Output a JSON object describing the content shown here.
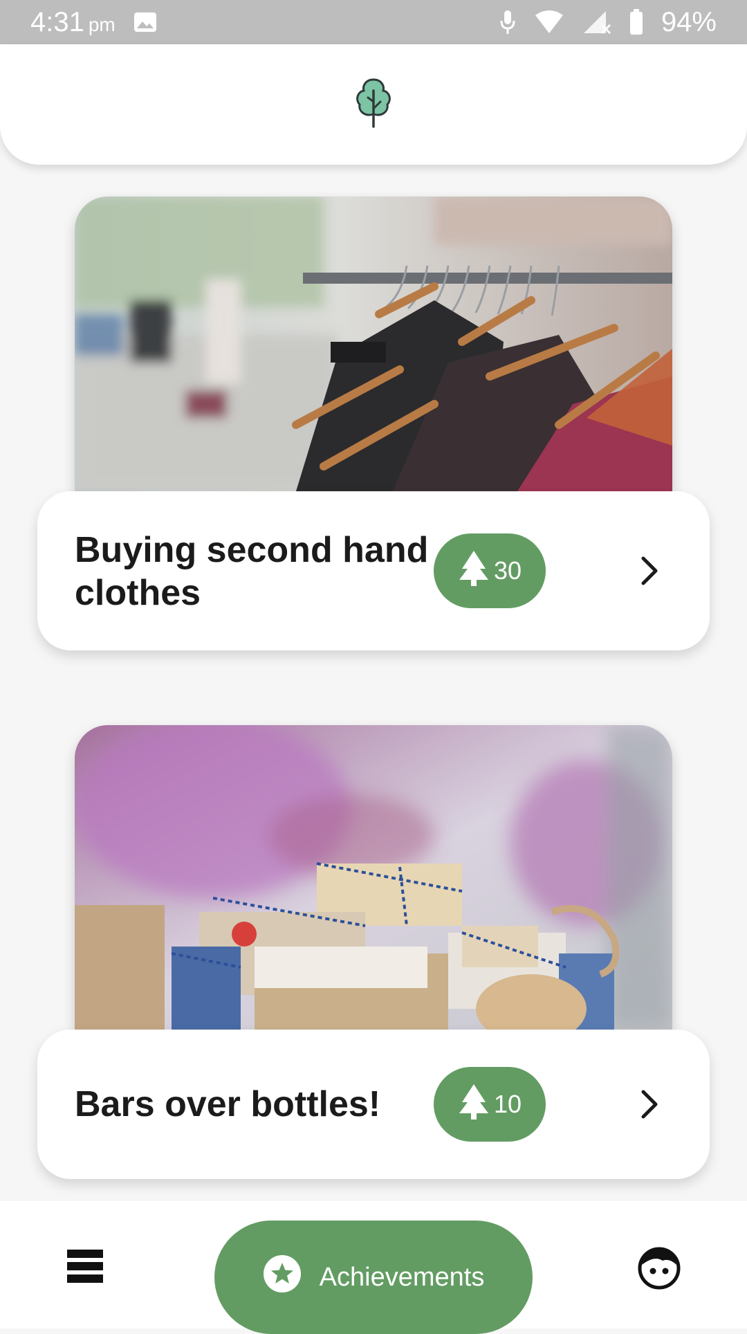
{
  "status_bar": {
    "time": "4:31",
    "ampm": "pm",
    "battery": "94%"
  },
  "header": {
    "logo_icon": "tree-icon"
  },
  "cards": [
    {
      "title": "Buying second hand clothes",
      "points": "30",
      "points_icon": "pine-tree-icon",
      "image_subject": "clothing-rack-photo"
    },
    {
      "title": "Bars over bottles!",
      "points": "10",
      "points_icon": "pine-tree-icon",
      "image_subject": "soap-bars-photo"
    }
  ],
  "bottom_nav": {
    "list_icon": "list-view-icon",
    "achievements_label": "Achievements",
    "achievements_icon": "star-badge-icon",
    "profile_icon": "profile-face-icon"
  },
  "colors": {
    "accent": "#639c63",
    "header_logo": "#7cc4a4",
    "status_bar": "#bdbdbd",
    "background": "#f6f6f6"
  }
}
